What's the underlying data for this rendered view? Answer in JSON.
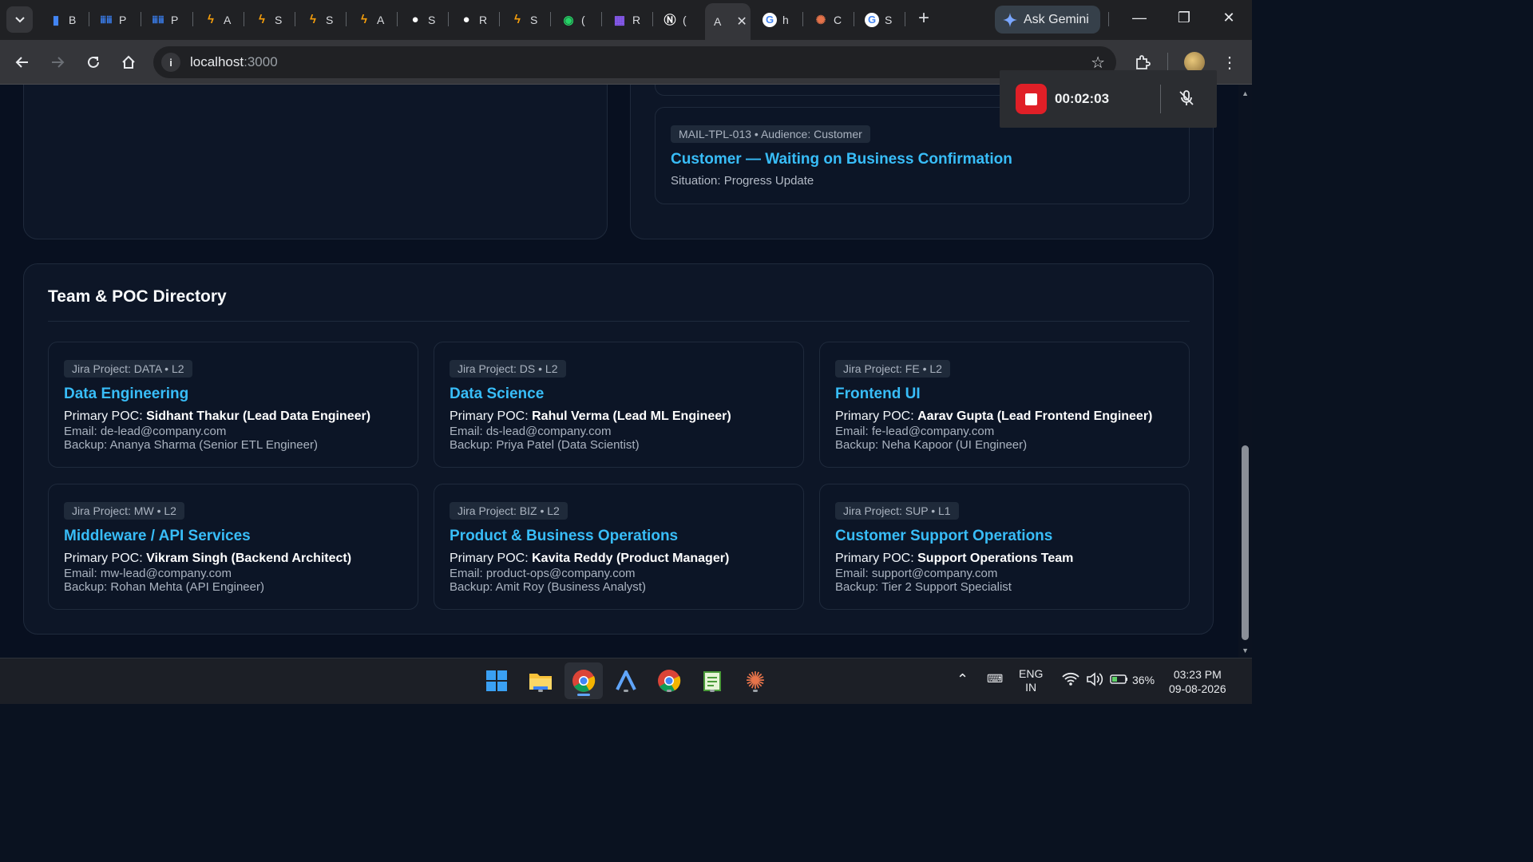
{
  "browser": {
    "tabs": [
      {
        "icon": "docs-icon",
        "label": "B"
      },
      {
        "icon": "project-icon",
        "label": "P"
      },
      {
        "icon": "project-icon",
        "label": "P"
      },
      {
        "icon": "bolt-icon",
        "label": "A"
      },
      {
        "icon": "bolt-icon",
        "label": "S"
      },
      {
        "icon": "bolt-icon",
        "label": "S"
      },
      {
        "icon": "bolt-icon",
        "label": "A"
      },
      {
        "icon": "github-icon",
        "label": "S"
      },
      {
        "icon": "github-icon",
        "label": "R"
      },
      {
        "icon": "bolt-icon",
        "label": "S"
      },
      {
        "icon": "whatsapp-icon",
        "label": "("
      },
      {
        "icon": "app-icon",
        "label": "R"
      },
      {
        "icon": "notion-icon",
        "label": "("
      },
      {
        "icon": "active-tab",
        "label": "A"
      },
      {
        "icon": "google-icon",
        "label": "h"
      },
      {
        "icon": "claude-icon",
        "label": "C"
      },
      {
        "icon": "google-icon",
        "label": "S"
      }
    ],
    "gemini_label": "Ask Gemini",
    "url_host": "localhost",
    "url_port": ":3000"
  },
  "recorder": {
    "time": "00:02:03"
  },
  "template_card": {
    "tag": "MAIL-TPL-013 • Audience: Customer",
    "title": "Customer — Waiting on Business Confirmation",
    "situation": "Situation: Progress Update"
  },
  "directory": {
    "title": "Team & POC Directory",
    "poc_label": "Primary POC:",
    "teams": [
      {
        "tag": "Jira Project: DATA • L2",
        "name": "Data Engineering",
        "poc": "Sidhant Thakur (Lead Data Engineer)",
        "email": "Email: de-lead@company.com",
        "backup": "Backup: Ananya Sharma (Senior ETL Engineer)"
      },
      {
        "tag": "Jira Project: DS • L2",
        "name": "Data Science",
        "poc": "Rahul Verma (Lead ML Engineer)",
        "email": "Email: ds-lead@company.com",
        "backup": "Backup: Priya Patel (Data Scientist)"
      },
      {
        "tag": "Jira Project: FE • L2",
        "name": "Frontend UI",
        "poc": "Aarav Gupta (Lead Frontend Engineer)",
        "email": "Email: fe-lead@company.com",
        "backup": "Backup: Neha Kapoor (UI Engineer)"
      },
      {
        "tag": "Jira Project: MW • L2",
        "name": "Middleware / API Services",
        "poc": "Vikram Singh (Backend Architect)",
        "email": "Email: mw-lead@company.com",
        "backup": "Backup: Rohan Mehta (API Engineer)"
      },
      {
        "tag": "Jira Project: BIZ • L2",
        "name": "Product & Business Operations",
        "poc": "Kavita Reddy (Product Manager)",
        "email": "Email: product-ops@company.com",
        "backup": "Backup: Amit Roy (Business Analyst)"
      },
      {
        "tag": "Jira Project: SUP • L1",
        "name": "Customer Support Operations",
        "poc": "Support Operations Team",
        "email": "Email: support@company.com",
        "backup": "Backup: Tier 2 Support Specialist"
      }
    ]
  },
  "taskbar": {
    "lang_top": "ENG",
    "lang_bottom": "IN",
    "battery": "36%",
    "time": "03:23 PM",
    "date": "09-08-2026"
  }
}
